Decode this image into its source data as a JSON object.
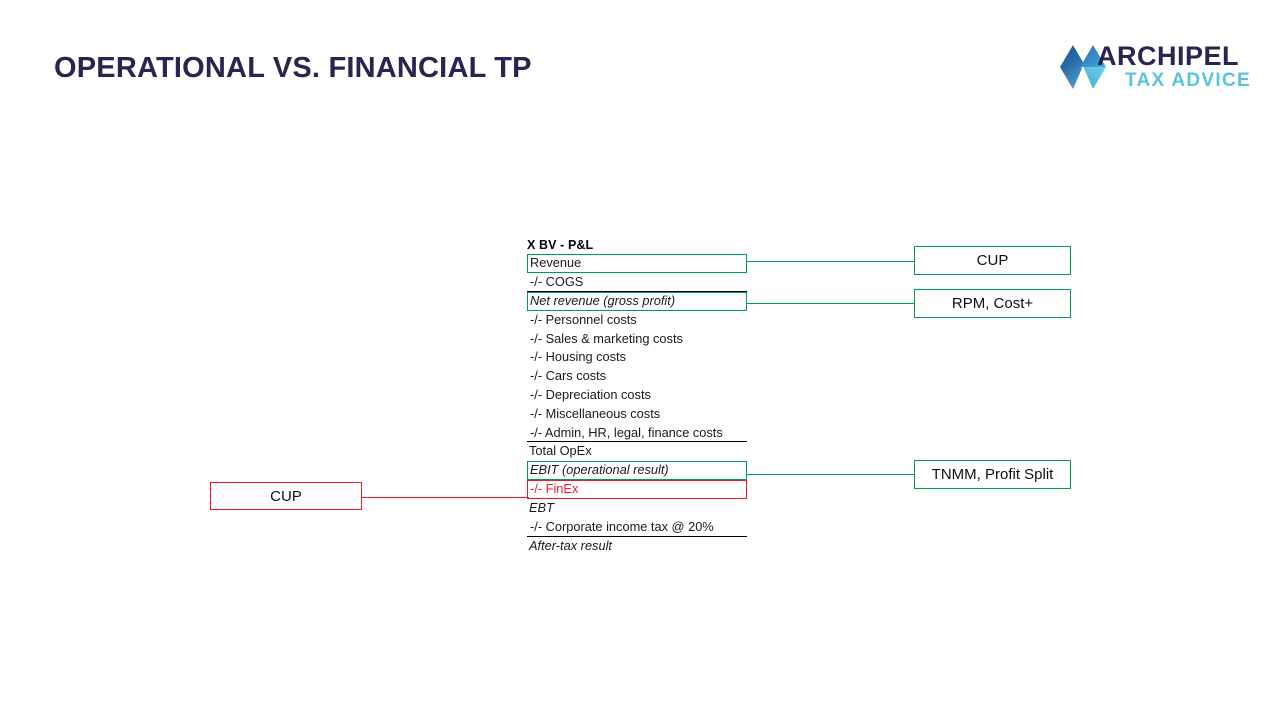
{
  "slide": {
    "title": "OPERATIONAL VS. FINANCIAL TP",
    "background": "#ffffff",
    "title_color": "#2b2350"
  },
  "logo": {
    "name": "ARCHIPEL",
    "tagline": "TAX ADVICE",
    "name_color": "#2b2350",
    "tagline_color": "#59c2e0",
    "mark_colors": [
      "#1d4f91",
      "#2f7fb5",
      "#3fa9d4",
      "#5bc3e0",
      "#2b5f9e"
    ]
  },
  "colors": {
    "green": "#00a04a",
    "red": "#ee1c25",
    "black": "#000000",
    "text": "#1a1a1a"
  },
  "pl_statement": {
    "header": "X BV - P&L",
    "rows": [
      {
        "label": "Revenue",
        "style": "boxed-green"
      },
      {
        "label": "-/- COGS",
        "style": "underline-black"
      },
      {
        "label": "Net revenue (gross profit)",
        "style": "boxed-green italic"
      },
      {
        "label": "-/- Personnel costs",
        "style": "plain"
      },
      {
        "label": "-/- Sales & marketing costs",
        "style": "plain"
      },
      {
        "label": "-/- Housing costs",
        "style": "plain"
      },
      {
        "label": "-/- Cars costs",
        "style": "plain"
      },
      {
        "label": "-/- Depreciation costs",
        "style": "plain"
      },
      {
        "label": "-/- Miscellaneous costs",
        "style": "plain"
      },
      {
        "label": "-/- Admin, HR, legal, finance costs",
        "style": "underline-black"
      },
      {
        "label": "Total OpEx",
        "style": "plain"
      },
      {
        "label": "EBIT (operational result)",
        "style": "boxed-green italic"
      },
      {
        "label": "-/- FinEx",
        "style": "boxed-red"
      },
      {
        "label": "EBT",
        "style": "italic"
      },
      {
        "label": "-/- Corporate income tax @ 20%",
        "style": "underline-black"
      },
      {
        "label": "After-tax result",
        "style": "italic"
      }
    ]
  },
  "method_boxes": {
    "cup_revenue": {
      "label": "CUP",
      "border": "#00a04a"
    },
    "rpm_costplus": {
      "label": "RPM, Cost+",
      "border": "#00a04a"
    },
    "tnmm_profitsplit": {
      "label": "TNMM, Profit Split",
      "border": "#00a04a"
    },
    "cup_finex": {
      "label": "CUP",
      "border": "#ee1c25"
    }
  }
}
